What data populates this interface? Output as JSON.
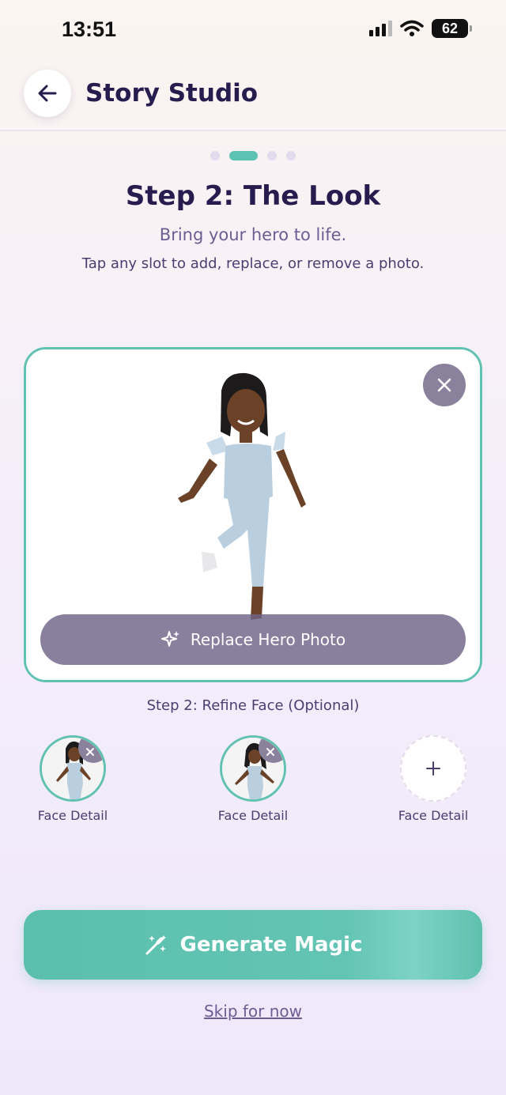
{
  "status_bar": {
    "time": "13:51",
    "battery": "62"
  },
  "header": {
    "title": "Story Studio",
    "back_icon": "arrow-left-icon"
  },
  "progress": {
    "total_steps": 4,
    "current_step": 2
  },
  "step": {
    "title": "Step 2: The Look",
    "subtitle": "Bring your hero to life.",
    "hint": "Tap any slot to add, replace, or remove a photo."
  },
  "hero": {
    "replace_label": "Replace Hero Photo",
    "replace_icon": "sparkle-icon",
    "remove_icon": "close-icon"
  },
  "refine": {
    "label": "Step 2: Refine Face (Optional)",
    "slots": [
      {
        "label": "Face Detail",
        "filled": true
      },
      {
        "label": "Face Detail",
        "filled": true
      },
      {
        "label": "Face Detail",
        "filled": false
      }
    ]
  },
  "actions": {
    "generate_label": "Generate Magic",
    "generate_icon": "magic-wand-icon",
    "skip_label": "Skip for now"
  },
  "colors": {
    "accent": "#5cc3b2",
    "title": "#261c4d",
    "muted": "#6f5c93",
    "overlay": "#8a819c"
  }
}
